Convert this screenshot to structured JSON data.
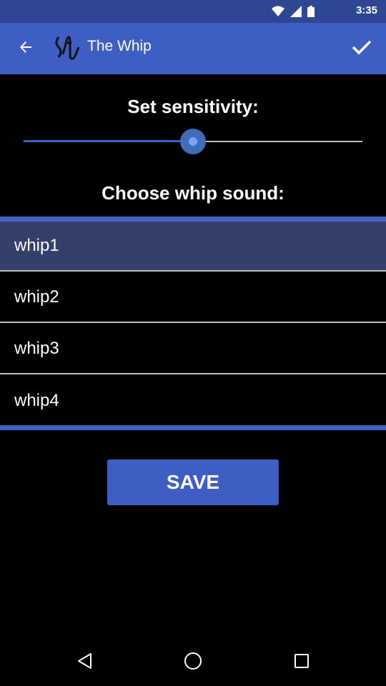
{
  "status_bar": {
    "time": "3:35"
  },
  "app_bar": {
    "title": "The Whip",
    "back_icon": "arrow-back-icon",
    "confirm_icon": "check-icon"
  },
  "sensitivity": {
    "label": "Set sensitivity:",
    "value_fraction": 0.5
  },
  "sound": {
    "label": "Choose whip sound:",
    "options": [
      "whip1",
      "whip2",
      "whip3",
      "whip4"
    ],
    "selected": "whip1"
  },
  "save_label": "SAVE",
  "colors": {
    "accent": "#3f5ec4",
    "status_bar": "#2f4792",
    "selected_row": "#34406a"
  }
}
